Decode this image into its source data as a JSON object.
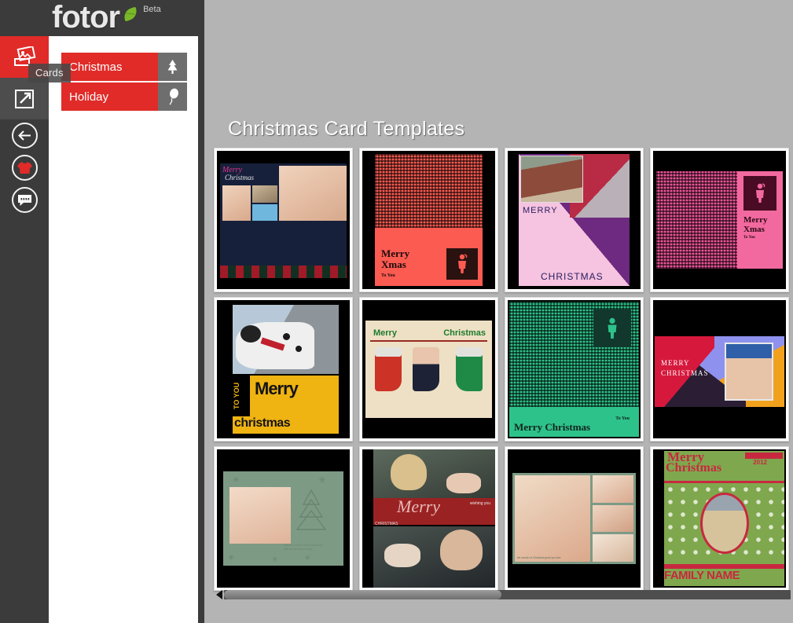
{
  "app": {
    "brand": "fotor",
    "badge": "Beta",
    "brand_color": "#e02b28",
    "header_bg": "#3b3b3b",
    "leaf_color": "#7ab829",
    "content_bg": "#b4b4b4"
  },
  "tooltip": {
    "text": "Cards"
  },
  "rail": {
    "items": [
      {
        "name": "cards-icon",
        "label": "Cards",
        "state": "active"
      },
      {
        "name": "export-icon",
        "label": "Export",
        "state": "alt"
      },
      {
        "name": "back-icon",
        "label": "Back",
        "state": "circle"
      },
      {
        "name": "tshirt-icon",
        "label": "Apparel",
        "state": "circle"
      },
      {
        "name": "chat-icon",
        "label": "Feedback",
        "state": "circle"
      }
    ]
  },
  "categories": {
    "items": [
      {
        "label": "Christmas",
        "icon": "tree-icon",
        "selected": true
      },
      {
        "label": "Holiday",
        "icon": "balloon-icon",
        "selected": false
      }
    ]
  },
  "main": {
    "title": "Christmas Card Templates",
    "templates": [
      {
        "id": 1,
        "name": "baby-collage-merry-christmas",
        "texts": [
          "Merry",
          "Christmas"
        ]
      },
      {
        "id": 2,
        "name": "red-tree-merry-xmas",
        "texts": [
          "Merry",
          "Xmas",
          "To You"
        ]
      },
      {
        "id": 3,
        "name": "house-purple-merry-christmas",
        "texts": [
          "MERRY",
          "CHRISTMAS"
        ]
      },
      {
        "id": 4,
        "name": "pink-tree-merry-xmas",
        "texts": [
          "Merry",
          "Xmas",
          "To You"
        ]
      },
      {
        "id": 5,
        "name": "dalmatian-merry-christmas",
        "texts": [
          "TO YOU",
          "Merry",
          "christmas"
        ]
      },
      {
        "id": 6,
        "name": "stockings-merry-christmas",
        "texts": [
          "Merry",
          "Christmas"
        ]
      },
      {
        "id": 7,
        "name": "green-merry-christmas",
        "texts": [
          "Merry  Christmas",
          "To You"
        ]
      },
      {
        "id": 8,
        "name": "geometric-twins-merry-christmas",
        "texts": [
          "MERRY",
          "CHRISTMAS"
        ]
      },
      {
        "id": 9,
        "name": "green-baby-tree-card",
        "texts": [
          "May the wonder of the season be with you and your family"
        ]
      },
      {
        "id": 10,
        "name": "family-merry-script-card",
        "texts": [
          "wishing you",
          "Merry",
          "CHRISTMAS"
        ]
      },
      {
        "id": 11,
        "name": "twins-photo-collage-card",
        "texts": [
          "the wonder of Christmas grant you love"
        ]
      },
      {
        "id": 12,
        "name": "dog-family-name-card",
        "texts": [
          "Merry",
          "Christmas",
          "2012",
          "FAMILY NAME"
        ]
      }
    ]
  },
  "scrollbar": {
    "orientation": "horizontal",
    "thumb_percent": 49,
    "left_arrow": "scroll-left-arrow"
  }
}
